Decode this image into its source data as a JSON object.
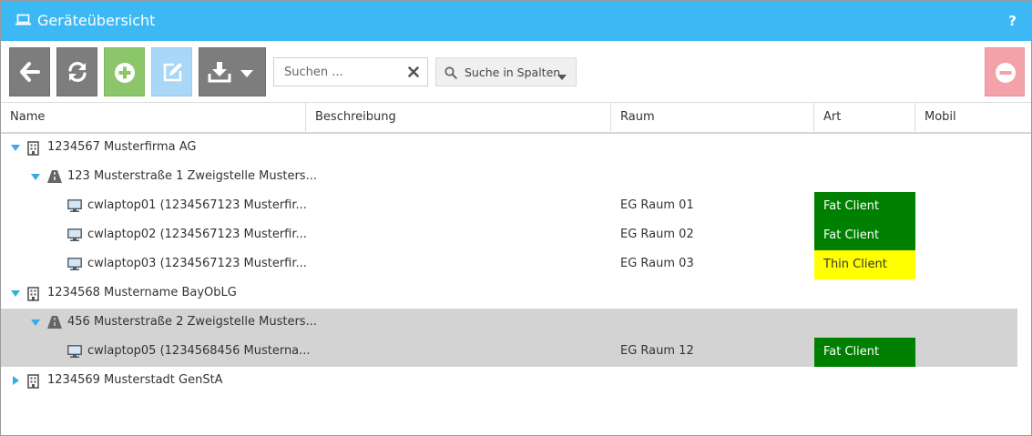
{
  "window": {
    "title": "Geräteübersicht",
    "help_label": "?"
  },
  "toolbar": {
    "search": {
      "placeholder": "Suchen ...",
      "value": ""
    },
    "column_search_label": "Suche in Spalten"
  },
  "columns": [
    "Name",
    "Beschreibung",
    "Raum",
    "Art",
    "Mobil"
  ],
  "rows": [
    {
      "name": "1234567 Musterfirma AG",
      "raum": "",
      "art": ""
    },
    {
      "name": "123 Musterstraße 1 Zweigstelle Musters...",
      "raum": "",
      "art": ""
    },
    {
      "name": "cwlaptop01 (1234567123 Musterfir...",
      "raum": "EG Raum 01",
      "art": "Fat Client"
    },
    {
      "name": "cwlaptop02 (1234567123 Musterfir...",
      "raum": "EG Raum 02",
      "art": "Fat Client"
    },
    {
      "name": "cwlaptop03 (1234567123 Musterfir...",
      "raum": "EG Raum 03",
      "art": "Thin Client"
    },
    {
      "name": "1234568 Mustername BayObLG",
      "raum": "",
      "art": ""
    },
    {
      "name": "456 Musterstraße 2 Zweigstelle Musters...",
      "raum": "",
      "art": ""
    },
    {
      "name": "cwlaptop05 (1234568456 Musterna...",
      "raum": "EG Raum 12",
      "art": "Fat Client"
    },
    {
      "name": "1234569 Musterstadt GenStA",
      "raum": "",
      "art": ""
    }
  ],
  "colors": {
    "title_bar": "#3cb8f5",
    "fat_client": "#008000",
    "thin_client": "#ffff00",
    "selection": "#d3d3d3",
    "add_button": "#8cc66a",
    "edit_button": "#a9d7f7",
    "remove_button": "#f2a2a8"
  }
}
